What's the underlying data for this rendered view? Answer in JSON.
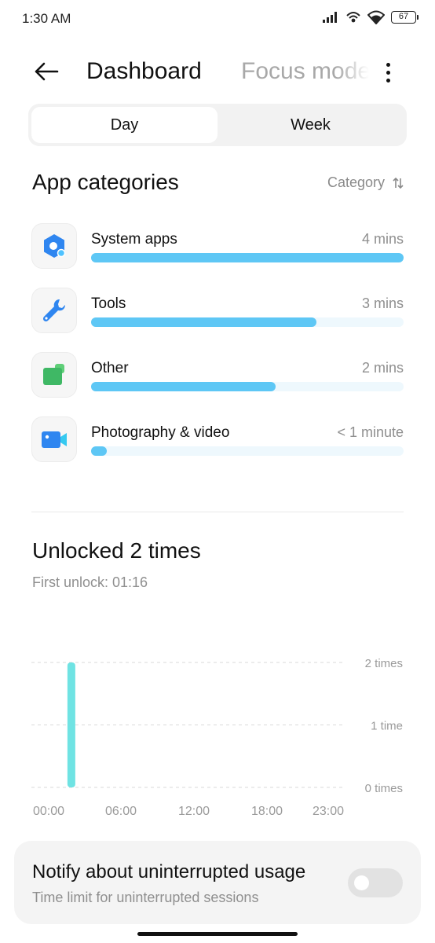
{
  "status_bar": {
    "time": "1:30 AM",
    "battery": "67",
    "icons": [
      "signal-icon",
      "hotspot-icon",
      "wifi-icon",
      "battery-icon"
    ]
  },
  "header": {
    "back_icon": "arrow-left-icon",
    "tab_active": "Dashboard",
    "tab_other": "Focus mode",
    "more_icon": "more-vertical-icon"
  },
  "period": {
    "options": [
      "Day",
      "Week"
    ],
    "selected": "Day"
  },
  "app_categories": {
    "title": "App categories",
    "sort_label": "Category",
    "sort_icon": "sort-icon",
    "items": [
      {
        "name": "System apps",
        "time": "4 mins",
        "share": 1.0,
        "icon": "system-apps-icon"
      },
      {
        "name": "Tools",
        "time": "3 mins",
        "share": 0.72,
        "icon": "wrench-icon"
      },
      {
        "name": "Other",
        "time": "2 mins",
        "share": 0.59,
        "icon": "other-apps-icon"
      },
      {
        "name": "Photography & video",
        "time": "< 1 minute",
        "share": 0.05,
        "icon": "video-camera-icon"
      }
    ]
  },
  "unlocks": {
    "title": "Unlocked 2 times",
    "first_unlock": "First unlock: 01:16"
  },
  "chart_data": {
    "type": "bar",
    "categories": [
      "00:00",
      "06:00",
      "12:00",
      "18:00",
      "23:00"
    ],
    "y_ticks": [
      "0 times",
      "1 time",
      "2 times"
    ],
    "ylim": [
      0,
      2
    ],
    "x_range_hours": [
      0,
      23
    ],
    "series": [
      {
        "values": [
          {
            "hour": 1,
            "value": 2
          }
        ]
      }
    ],
    "bar_color": "#6fe3e3",
    "grid": true
  },
  "notify": {
    "title": "Notify about uninterrupted usage",
    "subtitle": "Time limit for uninterrupted sessions",
    "enabled": false
  },
  "colors": {
    "accent": "#5ec7f5",
    "track": "#eef8fd",
    "muted_text": "#8f8f8f"
  }
}
